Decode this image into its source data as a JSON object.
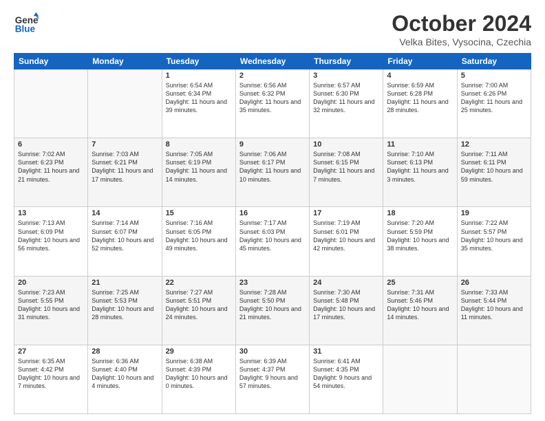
{
  "logo": {
    "line1": "General",
    "line2": "Blue"
  },
  "title": "October 2024",
  "location": "Velka Bites, Vysocina, Czechia",
  "weekdays": [
    "Sunday",
    "Monday",
    "Tuesday",
    "Wednesday",
    "Thursday",
    "Friday",
    "Saturday"
  ],
  "weeks": [
    [
      {
        "day": "",
        "sunrise": "",
        "sunset": "",
        "daylight": ""
      },
      {
        "day": "",
        "sunrise": "",
        "sunset": "",
        "daylight": ""
      },
      {
        "day": "1",
        "sunrise": "Sunrise: 6:54 AM",
        "sunset": "Sunset: 6:34 PM",
        "daylight": "Daylight: 11 hours and 39 minutes."
      },
      {
        "day": "2",
        "sunrise": "Sunrise: 6:56 AM",
        "sunset": "Sunset: 6:32 PM",
        "daylight": "Daylight: 11 hours and 35 minutes."
      },
      {
        "day": "3",
        "sunrise": "Sunrise: 6:57 AM",
        "sunset": "Sunset: 6:30 PM",
        "daylight": "Daylight: 11 hours and 32 minutes."
      },
      {
        "day": "4",
        "sunrise": "Sunrise: 6:59 AM",
        "sunset": "Sunset: 6:28 PM",
        "daylight": "Daylight: 11 hours and 28 minutes."
      },
      {
        "day": "5",
        "sunrise": "Sunrise: 7:00 AM",
        "sunset": "Sunset: 6:26 PM",
        "daylight": "Daylight: 11 hours and 25 minutes."
      }
    ],
    [
      {
        "day": "6",
        "sunrise": "Sunrise: 7:02 AM",
        "sunset": "Sunset: 6:23 PM",
        "daylight": "Daylight: 11 hours and 21 minutes."
      },
      {
        "day": "7",
        "sunrise": "Sunrise: 7:03 AM",
        "sunset": "Sunset: 6:21 PM",
        "daylight": "Daylight: 11 hours and 17 minutes."
      },
      {
        "day": "8",
        "sunrise": "Sunrise: 7:05 AM",
        "sunset": "Sunset: 6:19 PM",
        "daylight": "Daylight: 11 hours and 14 minutes."
      },
      {
        "day": "9",
        "sunrise": "Sunrise: 7:06 AM",
        "sunset": "Sunset: 6:17 PM",
        "daylight": "Daylight: 11 hours and 10 minutes."
      },
      {
        "day": "10",
        "sunrise": "Sunrise: 7:08 AM",
        "sunset": "Sunset: 6:15 PM",
        "daylight": "Daylight: 11 hours and 7 minutes."
      },
      {
        "day": "11",
        "sunrise": "Sunrise: 7:10 AM",
        "sunset": "Sunset: 6:13 PM",
        "daylight": "Daylight: 11 hours and 3 minutes."
      },
      {
        "day": "12",
        "sunrise": "Sunrise: 7:11 AM",
        "sunset": "Sunset: 6:11 PM",
        "daylight": "Daylight: 10 hours and 59 minutes."
      }
    ],
    [
      {
        "day": "13",
        "sunrise": "Sunrise: 7:13 AM",
        "sunset": "Sunset: 6:09 PM",
        "daylight": "Daylight: 10 hours and 56 minutes."
      },
      {
        "day": "14",
        "sunrise": "Sunrise: 7:14 AM",
        "sunset": "Sunset: 6:07 PM",
        "daylight": "Daylight: 10 hours and 52 minutes."
      },
      {
        "day": "15",
        "sunrise": "Sunrise: 7:16 AM",
        "sunset": "Sunset: 6:05 PM",
        "daylight": "Daylight: 10 hours and 49 minutes."
      },
      {
        "day": "16",
        "sunrise": "Sunrise: 7:17 AM",
        "sunset": "Sunset: 6:03 PM",
        "daylight": "Daylight: 10 hours and 45 minutes."
      },
      {
        "day": "17",
        "sunrise": "Sunrise: 7:19 AM",
        "sunset": "Sunset: 6:01 PM",
        "daylight": "Daylight: 10 hours and 42 minutes."
      },
      {
        "day": "18",
        "sunrise": "Sunrise: 7:20 AM",
        "sunset": "Sunset: 5:59 PM",
        "daylight": "Daylight: 10 hours and 38 minutes."
      },
      {
        "day": "19",
        "sunrise": "Sunrise: 7:22 AM",
        "sunset": "Sunset: 5:57 PM",
        "daylight": "Daylight: 10 hours and 35 minutes."
      }
    ],
    [
      {
        "day": "20",
        "sunrise": "Sunrise: 7:23 AM",
        "sunset": "Sunset: 5:55 PM",
        "daylight": "Daylight: 10 hours and 31 minutes."
      },
      {
        "day": "21",
        "sunrise": "Sunrise: 7:25 AM",
        "sunset": "Sunset: 5:53 PM",
        "daylight": "Daylight: 10 hours and 28 minutes."
      },
      {
        "day": "22",
        "sunrise": "Sunrise: 7:27 AM",
        "sunset": "Sunset: 5:51 PM",
        "daylight": "Daylight: 10 hours and 24 minutes."
      },
      {
        "day": "23",
        "sunrise": "Sunrise: 7:28 AM",
        "sunset": "Sunset: 5:50 PM",
        "daylight": "Daylight: 10 hours and 21 minutes."
      },
      {
        "day": "24",
        "sunrise": "Sunrise: 7:30 AM",
        "sunset": "Sunset: 5:48 PM",
        "daylight": "Daylight: 10 hours and 17 minutes."
      },
      {
        "day": "25",
        "sunrise": "Sunrise: 7:31 AM",
        "sunset": "Sunset: 5:46 PM",
        "daylight": "Daylight: 10 hours and 14 minutes."
      },
      {
        "day": "26",
        "sunrise": "Sunrise: 7:33 AM",
        "sunset": "Sunset: 5:44 PM",
        "daylight": "Daylight: 10 hours and 11 minutes."
      }
    ],
    [
      {
        "day": "27",
        "sunrise": "Sunrise: 6:35 AM",
        "sunset": "Sunset: 4:42 PM",
        "daylight": "Daylight: 10 hours and 7 minutes."
      },
      {
        "day": "28",
        "sunrise": "Sunrise: 6:36 AM",
        "sunset": "Sunset: 4:40 PM",
        "daylight": "Daylight: 10 hours and 4 minutes."
      },
      {
        "day": "29",
        "sunrise": "Sunrise: 6:38 AM",
        "sunset": "Sunset: 4:39 PM",
        "daylight": "Daylight: 10 hours and 0 minutes."
      },
      {
        "day": "30",
        "sunrise": "Sunrise: 6:39 AM",
        "sunset": "Sunset: 4:37 PM",
        "daylight": "Daylight: 9 hours and 57 minutes."
      },
      {
        "day": "31",
        "sunrise": "Sunrise: 6:41 AM",
        "sunset": "Sunset: 4:35 PM",
        "daylight": "Daylight: 9 hours and 54 minutes."
      },
      {
        "day": "",
        "sunrise": "",
        "sunset": "",
        "daylight": ""
      },
      {
        "day": "",
        "sunrise": "",
        "sunset": "",
        "daylight": ""
      }
    ]
  ]
}
